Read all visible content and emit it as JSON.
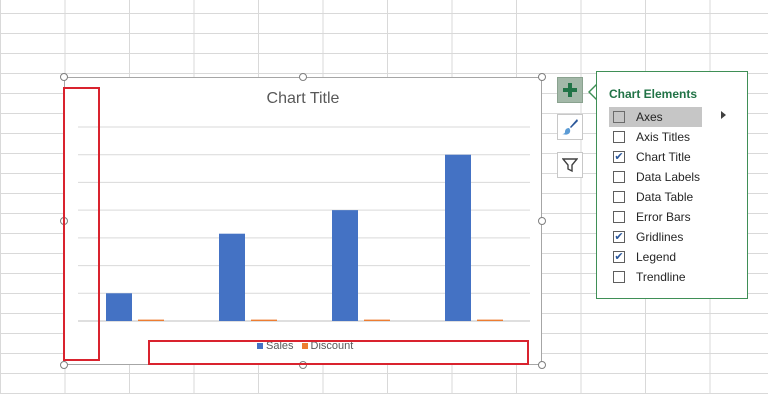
{
  "chart_data": {
    "type": "bar",
    "title": "Chart Title",
    "categories": [
      "",
      "",
      "",
      ""
    ],
    "series": [
      {
        "name": "Sales",
        "color": "#4472c4",
        "values": [
          20,
          63,
          80,
          120
        ]
      },
      {
        "name": "Discount",
        "color": "#ed7d31",
        "values": [
          1,
          1,
          1,
          1
        ]
      }
    ],
    "ylim": [
      0,
      140
    ],
    "grid": true,
    "legend_position": "bottom"
  },
  "chart_elements_panel": {
    "title": "Chart Elements",
    "options": [
      {
        "label": "Axes",
        "checked": false,
        "selected": true,
        "has_submenu": true
      },
      {
        "label": "Axis Titles",
        "checked": false
      },
      {
        "label": "Chart Title",
        "checked": true
      },
      {
        "label": "Data Labels",
        "checked": false
      },
      {
        "label": "Data Table",
        "checked": false
      },
      {
        "label": "Error Bars",
        "checked": false
      },
      {
        "label": "Gridlines",
        "checked": true
      },
      {
        "label": "Legend",
        "checked": true
      },
      {
        "label": "Trendline",
        "checked": false
      }
    ]
  },
  "side_buttons": [
    {
      "name": "chart-elements-button",
      "icon": "plus-icon"
    },
    {
      "name": "chart-styles-button",
      "icon": "paintbrush-icon"
    },
    {
      "name": "chart-filters-button",
      "icon": "funnel-icon"
    }
  ],
  "colors": {
    "accent": "#217346",
    "highlight": "#d9232e"
  }
}
